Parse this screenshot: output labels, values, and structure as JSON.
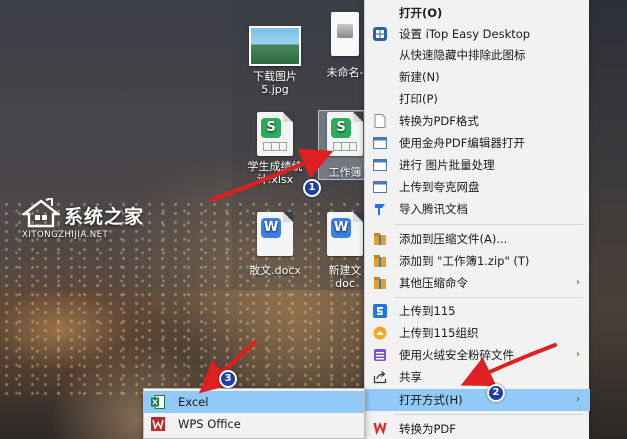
{
  "desktop": {
    "icons": [
      {
        "label": "下载图片\n5.jpg"
      },
      {
        "label": "未命名-"
      },
      {
        "label": "学生成绩统\n计.xlsx"
      },
      {
        "label": "工作簿"
      },
      {
        "label": "散文.docx"
      },
      {
        "label": "新建文\ndoc"
      }
    ]
  },
  "watermark": {
    "title": "系统之家",
    "subtitle": "XITONGZHIJIA.NET"
  },
  "context_menu": {
    "items": [
      {
        "label": "打开(O)",
        "icon": "none"
      },
      {
        "label": "设置 iTop Easy Desktop",
        "icon": "itop-icon"
      },
      {
        "label": "从快速隐藏中排除此图标",
        "icon": "none"
      },
      {
        "label": "新建(N)",
        "icon": "none"
      },
      {
        "label": "打印(P)",
        "icon": "none"
      },
      {
        "label": "转换为PDF格式",
        "icon": "pdf-page-icon"
      },
      {
        "label": "使用金舟PDF编辑器打开",
        "icon": "window-icon"
      },
      {
        "label": "进行 图片批量处理",
        "icon": "window-icon"
      },
      {
        "label": "上传到夸克网盘",
        "icon": "window-icon"
      },
      {
        "label": "导入腾讯文档",
        "icon": "tencent-docs-icon"
      },
      {
        "label": "添加到压缩文件(A)...",
        "icon": "archive-icon"
      },
      {
        "label": "添加到 \"工作簿1.zip\" (T)",
        "icon": "archive-icon"
      },
      {
        "label": "其他压缩命令",
        "icon": "archive-icon"
      },
      {
        "label": "上传到115",
        "icon": "cloud-115-icon"
      },
      {
        "label": "上传到115组织",
        "icon": "cloud-115-org-icon"
      },
      {
        "label": "使用火绒安全粉碎文件",
        "icon": "huorong-icon"
      },
      {
        "label": "共享",
        "icon": "share-icon"
      },
      {
        "label": "打开方式(H)",
        "icon": "none"
      },
      {
        "label": "转换为PDF",
        "icon": "wps-pdf-icon"
      }
    ],
    "arrow_glyph": "›"
  },
  "submenu": {
    "items": [
      {
        "label": "Excel",
        "icon": "excel-icon"
      },
      {
        "label": "WPS Office",
        "icon": "wps-icon"
      }
    ]
  },
  "callouts": {
    "one": "1",
    "two": "2",
    "three": "3"
  },
  "colors": {
    "highlight": "#91c9f7",
    "arrow_red": "#e02020",
    "callout_blue": "#1f3fa5",
    "wps_sheet": "#2bab5b",
    "wps_doc": "#3e7ee8"
  }
}
